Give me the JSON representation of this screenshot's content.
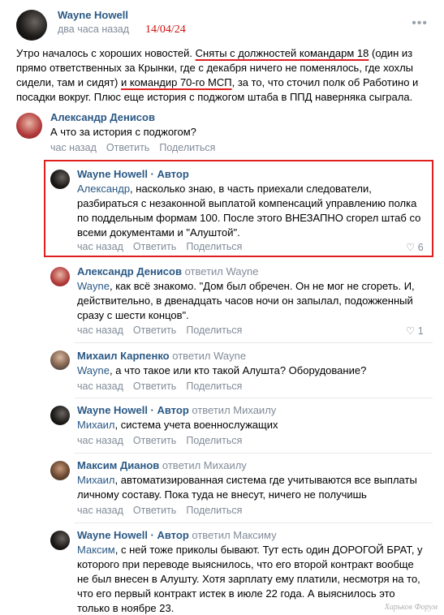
{
  "post": {
    "author": "Wayne Howell",
    "time": "два часа назад",
    "date_annotation": "14/04/24",
    "menu_icon": "more-dots-icon",
    "text_parts": [
      "Утро началось с хороших новостей. ",
      "Сняты с должностей командарм 18",
      " (один из прямо ответственных за Крынки, где с декабря ничего не поменялось, где хохлы сидели, там и сидят) ",
      "и командир 70-го МСП",
      ", за то, что сточил полк об Работино и посадки вокруг. Плюс еще история с поджогом штаба в ППД наверняка сыграла."
    ]
  },
  "actions": {
    "reply": "Ответить",
    "share": "Поделиться"
  },
  "comments": [
    {
      "author": "Александр Денисов",
      "reply_to": "",
      "text": "А что за история с поджогом?",
      "time": "час назад",
      "likes": ""
    },
    {
      "author": "Wayne Howell · Автор",
      "reply_to": "",
      "text_name": "Александр",
      "text": ", насколько знаю, в часть приехали следователи, разбираться с незаконной выплатой компенсаций управлению полка по поддельным формам 100. После этого ВНЕЗАПНО сгорел штаб со всеми документами и \"Алуштой\".",
      "time": "час назад",
      "likes": "6"
    },
    {
      "author": "Александр Денисов",
      "reply_to": "ответил Wayne",
      "text_name": "Wayne",
      "text": ", как всё знакомо. \"Дом был обречен. Он не мог не сгореть. И, действительно, в двенадцать часов ночи он запылал, подожженный сразу с шести концов\".",
      "time": "час назад",
      "likes": "1"
    },
    {
      "author": "Михаил Карпенко",
      "reply_to": "ответил Wayne",
      "text_name": "Wayne",
      "text": ", а что такое или кто такой Алушта? Оборудование?",
      "time": "час назад",
      "likes": ""
    },
    {
      "author": "Wayne Howell · Автор",
      "reply_to": "ответил Михаилу",
      "text_name": "Михаил",
      "text": ", система учета военнослужащих",
      "time": "час назад",
      "likes": ""
    },
    {
      "author": "Максим Дианов",
      "reply_to": "ответил Михаилу",
      "text_name": "Михаил",
      "text": ", автоматизированная система где учитываются все выплаты личному составу. Пока туда не внесут, ничего не получишь",
      "time": "час назад",
      "likes": ""
    },
    {
      "author": "Wayne Howell · Автор",
      "reply_to": "ответил Максиму",
      "text_name": "Максим",
      "text": ", с ней тоже приколы бывают. Тут есть один ДОРОГОЙ БРАТ, у которого при переводе выяснилось, что его второй контракт вообще не был внесен в Алушту. Хотя зарплату ему платили, несмотря на то, что его первый контракт истек в июле 22 года. А выяснилось это только в ноябре 23.",
      "time": "",
      "likes": ""
    }
  ],
  "watermark": "Харьков Форум"
}
